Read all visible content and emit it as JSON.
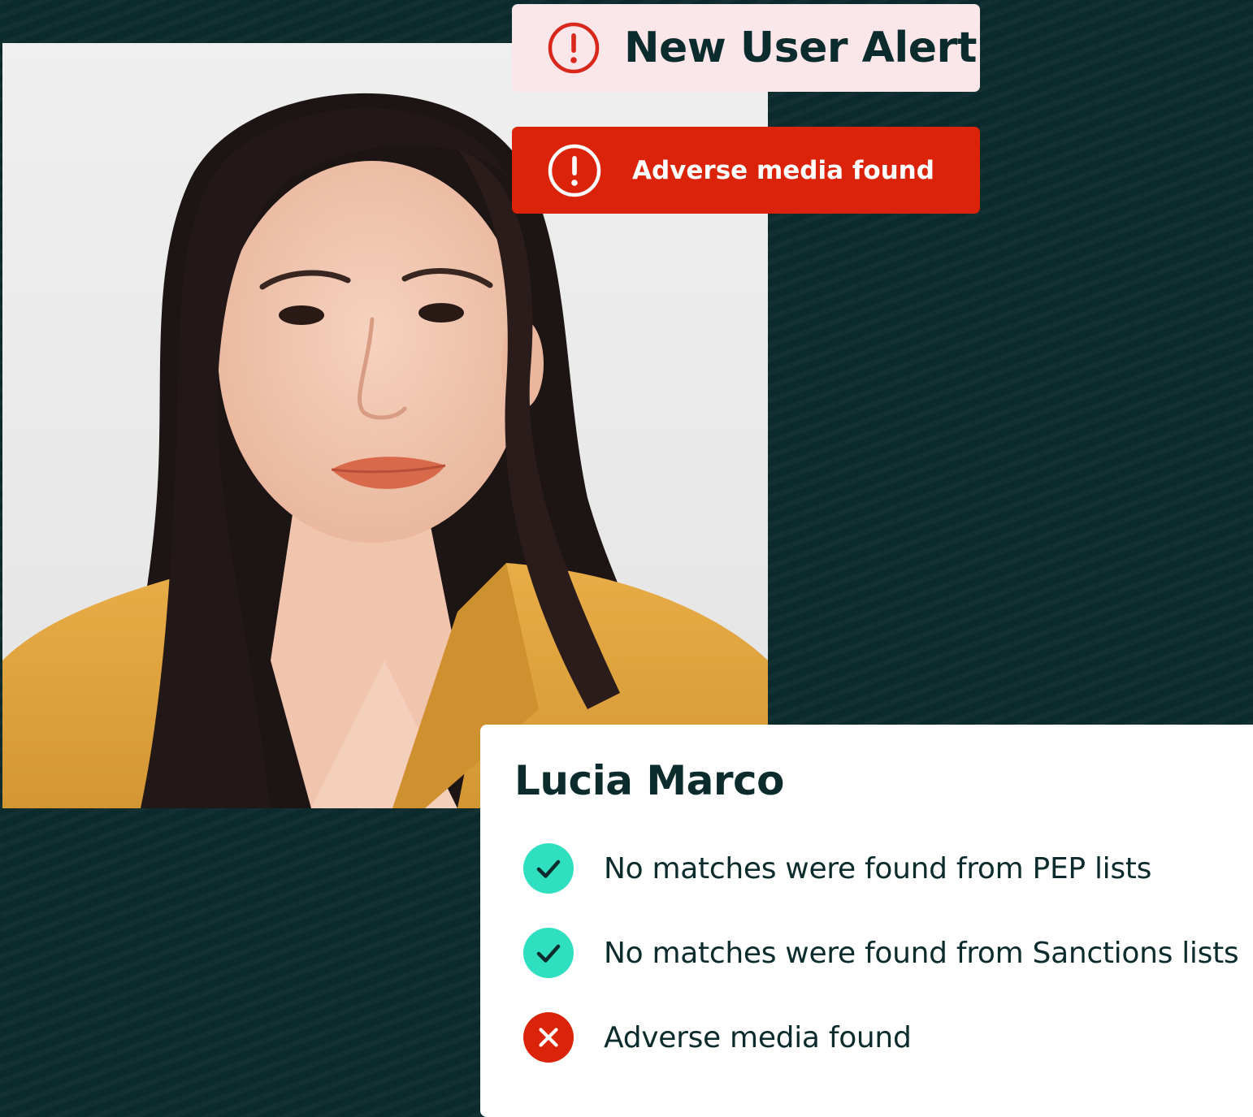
{
  "alert": {
    "title": "New User Alert",
    "icon": "exclamation-circle-icon",
    "background_color": "#fbe6ea",
    "icon_color": "#d9271c"
  },
  "adverse_banner": {
    "label": "Adverse media found",
    "icon": "exclamation-circle-icon",
    "background_color": "#da2308"
  },
  "user": {
    "name": "Lucia Marco"
  },
  "checks": [
    {
      "status": "pass",
      "icon": "check-circle-icon",
      "text": "No matches were found from PEP lists",
      "color": "#2ee0bf"
    },
    {
      "status": "pass",
      "icon": "check-circle-icon",
      "text": "No matches were found from Sanctions lists",
      "color": "#2ee0bf"
    },
    {
      "status": "fail",
      "icon": "x-circle-icon",
      "text": "Adverse media found",
      "color": "#da2308"
    }
  ],
  "theme": {
    "background": "#0b2a2b",
    "text_dark": "#0c2b2c",
    "jacket": "#e0a53f"
  }
}
